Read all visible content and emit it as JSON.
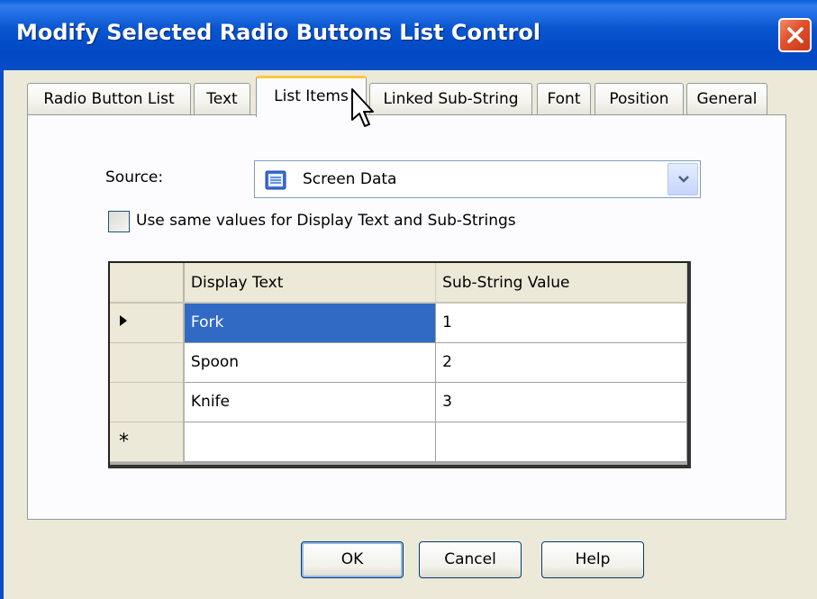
{
  "window": {
    "title": "Modify Selected Radio Buttons List Control"
  },
  "tabs": [
    {
      "label": "Radio Button List",
      "active": false
    },
    {
      "label": "Text",
      "active": false
    },
    {
      "label": "List Items",
      "active": true
    },
    {
      "label": "Linked Sub-String",
      "active": false
    },
    {
      "label": "Font",
      "active": false
    },
    {
      "label": "Position",
      "active": false
    },
    {
      "label": "General",
      "active": false
    }
  ],
  "source": {
    "label": "Source:",
    "value": "Screen Data",
    "icon": "document-icon"
  },
  "checkbox": {
    "label": "Use same values for Display Text and Sub-Strings",
    "checked": false
  },
  "grid": {
    "columns": [
      "Display Text",
      "Sub-String Value"
    ],
    "rows": [
      {
        "display_text": "Fork",
        "sub_string_value": "1",
        "current": true,
        "selected_cell": "display_text"
      },
      {
        "display_text": "Spoon",
        "sub_string_value": "2",
        "current": false
      },
      {
        "display_text": "Knife",
        "sub_string_value": "3",
        "current": false
      }
    ],
    "new_row_marker": "*"
  },
  "buttons": {
    "ok": "OK",
    "cancel": "Cancel",
    "help": "Help"
  },
  "colors": {
    "title_bar": "#0a4dc8",
    "selection": "#316ac5",
    "active_tab_accent": "#ffc83c",
    "close_button": "#e0502a"
  }
}
